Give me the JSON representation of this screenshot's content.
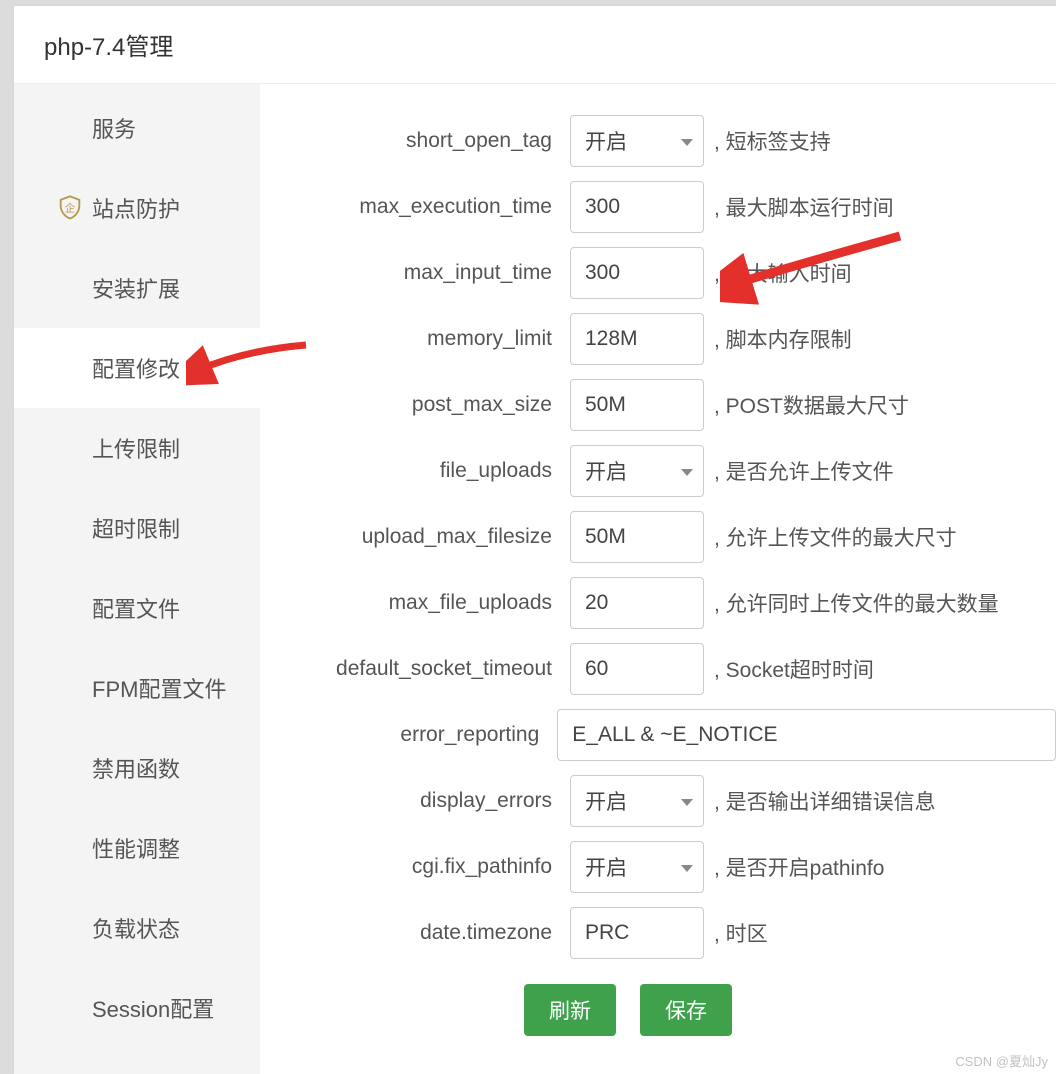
{
  "header": {
    "title": "php-7.4管理"
  },
  "sidebar": {
    "items": [
      {
        "label": "服务",
        "icon": null,
        "active": false
      },
      {
        "label": "站点防护",
        "icon": "shield-icon",
        "active": false
      },
      {
        "label": "安装扩展",
        "icon": null,
        "active": false
      },
      {
        "label": "配置修改",
        "icon": null,
        "active": true
      },
      {
        "label": "上传限制",
        "icon": null,
        "active": false
      },
      {
        "label": "超时限制",
        "icon": null,
        "active": false
      },
      {
        "label": "配置文件",
        "icon": null,
        "active": false
      },
      {
        "label": "FPM配置文件",
        "icon": null,
        "active": false
      },
      {
        "label": "禁用函数",
        "icon": null,
        "active": false
      },
      {
        "label": "性能调整",
        "icon": null,
        "active": false
      },
      {
        "label": "负载状态",
        "icon": null,
        "active": false
      },
      {
        "label": "Session配置",
        "icon": null,
        "active": false
      }
    ]
  },
  "select": {
    "open_label": "开启"
  },
  "form": {
    "rows": [
      {
        "key": "short_open_tag",
        "type": "select",
        "value": "开启",
        "desc": ", 短标签支持"
      },
      {
        "key": "max_execution_time",
        "type": "input",
        "value": "300",
        "desc": ", 最大脚本运行时间"
      },
      {
        "key": "max_input_time",
        "type": "input",
        "value": "300",
        "desc": ", 最大输入时间"
      },
      {
        "key": "memory_limit",
        "type": "input",
        "value": "128M",
        "desc": ", 脚本内存限制"
      },
      {
        "key": "post_max_size",
        "type": "input",
        "value": "50M",
        "desc": ", POST数据最大尺寸"
      },
      {
        "key": "file_uploads",
        "type": "select",
        "value": "开启",
        "desc": ", 是否允许上传文件"
      },
      {
        "key": "upload_max_filesize",
        "type": "input",
        "value": "50M",
        "desc": ", 允许上传文件的最大尺寸"
      },
      {
        "key": "max_file_uploads",
        "type": "input",
        "value": "20",
        "desc": ", 允许同时上传文件的最大数量"
      },
      {
        "key": "default_socket_timeout",
        "type": "input",
        "value": "60",
        "desc": ", Socket超时时间"
      },
      {
        "key": "error_reporting",
        "type": "input-wide",
        "value": "E_ALL & ~E_NOTICE",
        "desc": ""
      },
      {
        "key": "display_errors",
        "type": "select",
        "value": "开启",
        "desc": ", 是否输出详细错误信息"
      },
      {
        "key": "cgi.fix_pathinfo",
        "type": "select",
        "value": "开启",
        "desc": ", 是否开启pathinfo"
      },
      {
        "key": "date.timezone",
        "type": "input",
        "value": "PRC",
        "desc": ", 时区"
      }
    ]
  },
  "buttons": {
    "refresh": "刷新",
    "save": "保存"
  },
  "watermark": "CSDN @夏灿Jy",
  "annotations": {
    "arrow_color": "#e4302a",
    "arrows": [
      {
        "target": "sidebar-item-config",
        "from": "right"
      },
      {
        "target": "max_input_time-value",
        "from": "right"
      }
    ]
  }
}
